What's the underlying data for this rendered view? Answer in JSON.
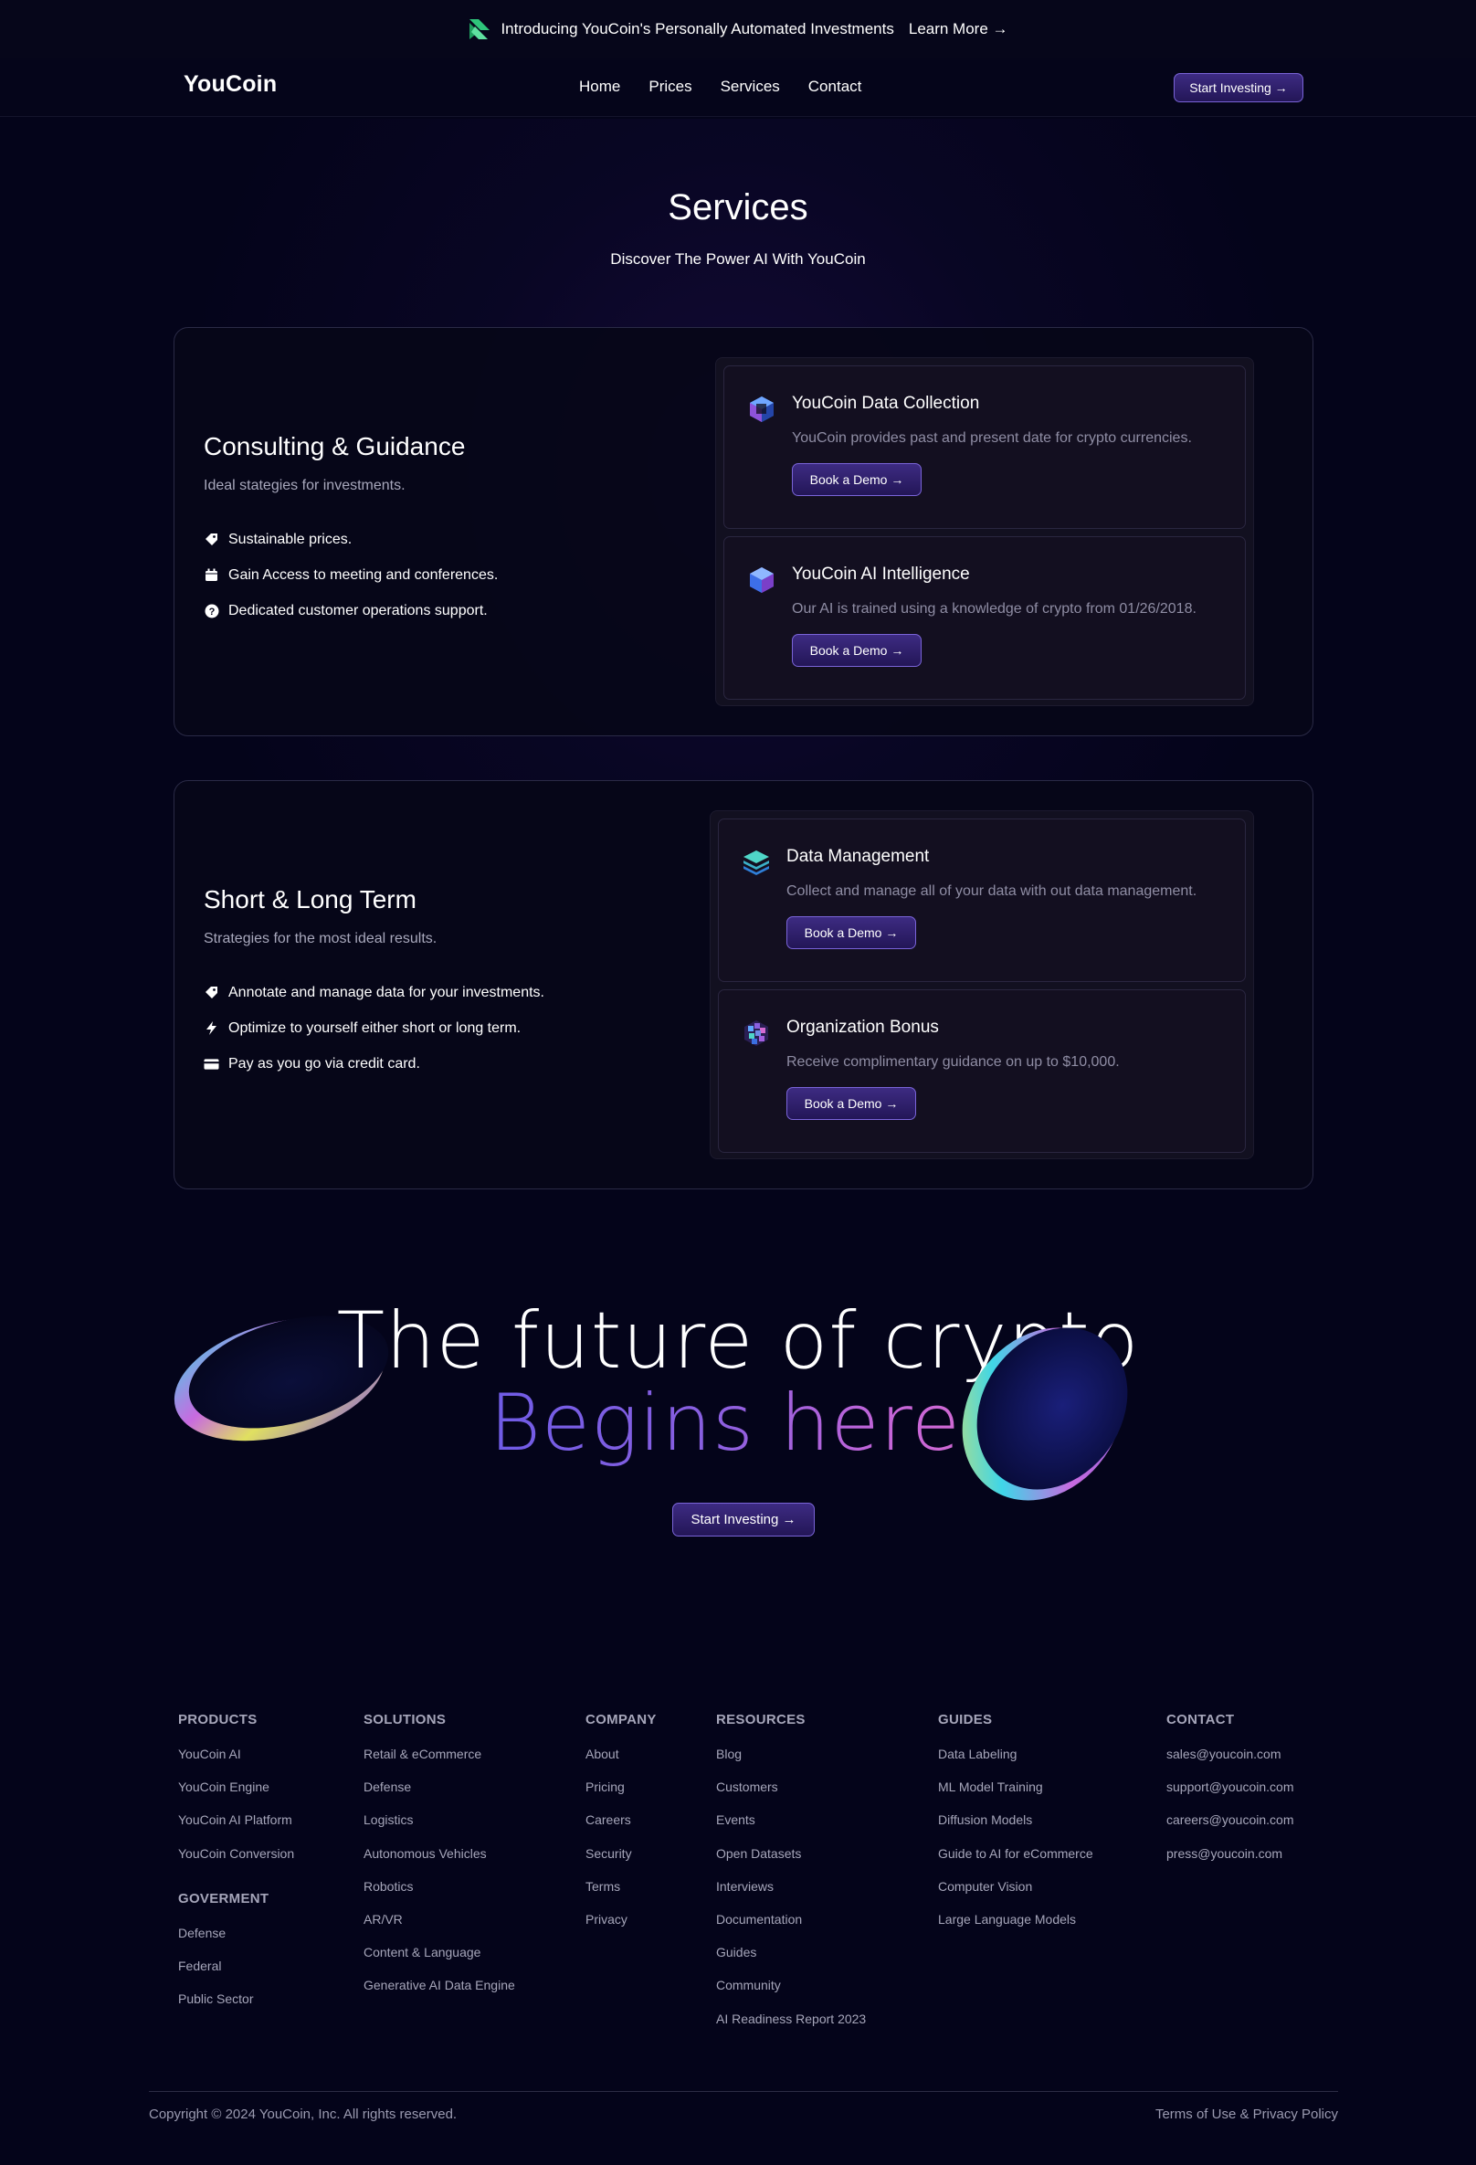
{
  "announcement": {
    "text": "Introducing YouCoin's Personally Automated Investments",
    "link": "Learn More →"
  },
  "header": {
    "brand": "YouCoin",
    "nav": [
      "Home",
      "Prices",
      "Services",
      "Contact"
    ],
    "cta": "Start Investing →"
  },
  "hero": {
    "title": "Services",
    "subtitle": "Discover The Power AI With YouCoin"
  },
  "services": [
    {
      "title": "Consulting & Guidance",
      "subtitle": "Ideal stategies for investments.",
      "features": [
        {
          "icon": "tag-icon",
          "text": "Sustainable prices."
        },
        {
          "icon": "calendar-icon",
          "text": "Gain Access to meeting and conferences."
        },
        {
          "icon": "help-circle-icon",
          "text": "Dedicated customer operations support."
        }
      ],
      "cards": [
        {
          "icon": "cube-icon",
          "title": "YouCoin Data Collection",
          "desc": "YouCoin provides past and present date for crypto currencies.",
          "button": "Book a Demo →"
        },
        {
          "icon": "hexagon-icon",
          "title": "YouCoin AI Intelligence",
          "desc": "Our AI is trained using a knowledge of crypto from 01/26/2018.",
          "button": "Book a Demo →"
        }
      ]
    },
    {
      "title": "Short & Long Term",
      "subtitle": "Strategies for the most ideal results.",
      "features": [
        {
          "icon": "tag-icon",
          "text": "Annotate and manage data for your investments."
        },
        {
          "icon": "bolt-icon",
          "text": "Optimize to yourself either short or long term."
        },
        {
          "icon": "credit-card-icon",
          "text": "Pay as you go via credit card."
        }
      ],
      "cards": [
        {
          "icon": "layers-icon",
          "title": "Data Management",
          "desc": "Collect and manage all of your data with out data management.",
          "button": "Book a Demo →"
        },
        {
          "icon": "grid-cube-icon",
          "title": "Organization Bonus",
          "desc": "Receive complimentary guidance on up to $10,000.",
          "button": "Book a Demo →"
        }
      ]
    }
  ],
  "cta": {
    "line1": "The future of crypto",
    "line2": "Begins here.",
    "button": "Start Investing →"
  },
  "footer": {
    "columns": [
      {
        "heading": "PRODUCTS",
        "links": [
          "YouCoin AI",
          "YouCoin Engine",
          "YouCoin AI Platform",
          "YouCoin Conversion"
        ],
        "heading2": "GOVERMENT",
        "links2": [
          "Defense",
          "Federal",
          "Public Sector"
        ]
      },
      {
        "heading": "SOLUTIONS",
        "links": [
          "Retail & eCommerce",
          "Defense",
          "Logistics",
          "Autonomous Vehicles",
          "Robotics",
          "AR/VR",
          "Content & Language",
          "Generative AI Data Engine"
        ]
      },
      {
        "heading": "COMPANY",
        "links": [
          "About",
          "Pricing",
          "Careers",
          "Security",
          "Terms",
          "Privacy"
        ]
      },
      {
        "heading": "RESOURCES",
        "links": [
          "Blog",
          "Customers",
          "Events",
          "Open Datasets",
          "Interviews",
          "Documentation",
          "Guides",
          "Community",
          "AI Readiness Report 2023"
        ]
      },
      {
        "heading": "GUIDES",
        "links": [
          "Data Labeling",
          "ML Model Training",
          "Diffusion Models",
          "Guide to AI for eCommerce",
          "Computer Vision",
          "Large Language Models"
        ]
      },
      {
        "heading": "CONTACT",
        "links": [
          "sales@youcoin.com",
          "support@youcoin.com",
          "careers@youcoin.com",
          "press@youcoin.com"
        ]
      }
    ],
    "copyright": "Copyright © 2024 YouCoin, Inc. All rights reserved.",
    "legal": "Terms of Use & Privacy Policy"
  },
  "colors": {
    "background": "#04041a",
    "accent": "#3d2b82",
    "accent_border": "#7a64d8",
    "gradient_start": "#6f5ce6",
    "gradient_end": "#d46ad2"
  }
}
